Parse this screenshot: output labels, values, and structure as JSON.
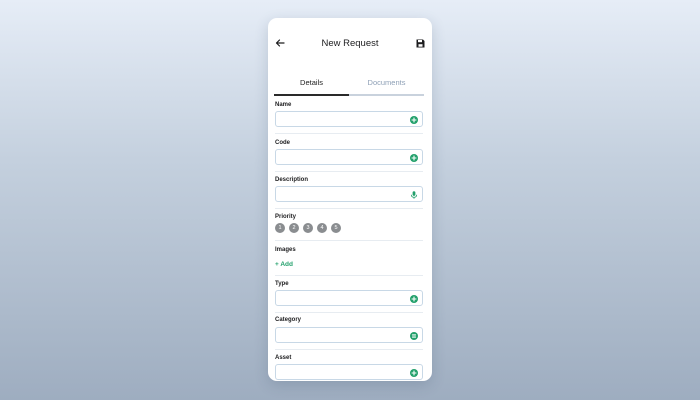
{
  "header": {
    "title": "New Request"
  },
  "tabs": [
    {
      "label": "Details"
    },
    {
      "label": "Documents"
    }
  ],
  "fields": {
    "name": {
      "label": "Name",
      "value": ""
    },
    "code": {
      "label": "Code",
      "value": ""
    },
    "description": {
      "label": "Description",
      "value": ""
    },
    "type": {
      "label": "Type",
      "value": ""
    },
    "category": {
      "label": "Category",
      "value": ""
    },
    "asset": {
      "label": "Asset",
      "value": ""
    }
  },
  "priority": {
    "label": "Priority",
    "levels": [
      "1",
      "2",
      "3",
      "4",
      "5"
    ]
  },
  "images": {
    "label": "Images",
    "add_label": "+ Add"
  },
  "icons": {
    "back": "arrow-left-icon",
    "save": "floppy-disk-icon",
    "add": "plus-circle-icon",
    "mic": "microphone-icon",
    "list": "list-circle-icon"
  },
  "colors": {
    "accent": "#22a06b",
    "priority_dot": "#8a8d90",
    "inactive_tab": "#8ea0b6"
  }
}
